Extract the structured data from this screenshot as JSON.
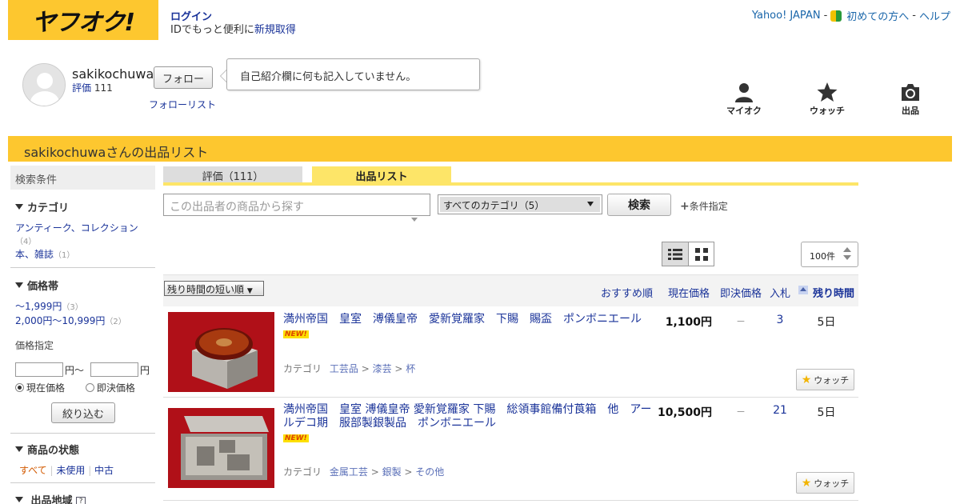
{
  "header": {
    "logo_text": "ヤフオク!",
    "login": "ログイン",
    "id_prefix": "IDでもっと便利に",
    "signup": "新規取得",
    "links": [
      "Yahoo! JAPAN",
      "初めての方へ",
      "ヘルプ"
    ],
    "separator": "-"
  },
  "seller": {
    "name": "sakikochuwa",
    "rating_label": "評価",
    "rating_value": "111",
    "follow": "フォロー",
    "follow_list": "フォローリスト",
    "bio": "自己紹介欄に何も記入していません。"
  },
  "nav": {
    "myauc": "マイオク",
    "watch": "ウォッチ",
    "sell": "出品"
  },
  "list_title": "sakikochuwaさんの出品リスト",
  "tabs": {
    "rating": "評価（111）",
    "listing": "出品リスト"
  },
  "search": {
    "placeholder": "この出品者の商品から探す",
    "category": "すべてのカテゴリ（5）",
    "button": "検索",
    "conditions": "条件指定"
  },
  "per_page": "100件",
  "sidebar": {
    "header": "検索条件",
    "category_title": "カテゴリ",
    "categories": [
      {
        "label": "アンティーク、コレクション",
        "count": "（4）"
      },
      {
        "label": "本、雑誌",
        "count": "（1）"
      }
    ],
    "price_title": "価格帯",
    "prices": [
      {
        "label": "〜1,999円",
        "count": "（3）"
      },
      {
        "label": "2,000円〜10,999円",
        "count": "（2）"
      }
    ],
    "price_specify": "価格指定",
    "yen_tilde": "円〜",
    "yen": "円",
    "radio_current": "現在価格",
    "radio_buynow": "即決価格",
    "narrow": "絞り込む",
    "condition_title": "商品の状態",
    "conditions": [
      "すべて",
      "未使用",
      "中古"
    ],
    "region_title": "出品地域"
  },
  "sort": {
    "select": "残り時間の短い順",
    "recommended": "おすすめ順",
    "current_price": "現在価格",
    "buynow": "即決価格",
    "bids": "入札",
    "time_left": "残り時間"
  },
  "items": [
    {
      "title": "満州帝国　皇室　溥儀皇帝　愛新覚羅家　下賜　賜盃　ポンボニエール",
      "new": "NEW!",
      "cat_label": "カテゴリ",
      "cats": [
        "工芸品",
        "漆芸",
        "杯"
      ],
      "price": "1,100円",
      "buynow": "－",
      "bids": "3",
      "time": "5日",
      "watch": "ウォッチ"
    },
    {
      "title": "満州帝国　皇室 溥儀皇帝 愛新覚羅家 下賜　総領事館備付莨箱　他　アールデコ期　服部製銀製品　ポンボニエール",
      "new": "NEW!",
      "cat_label": "カテゴリ",
      "cats": [
        "金属工芸",
        "銀製",
        "その他"
      ],
      "price": "10,500円",
      "buynow": "－",
      "bids": "21",
      "time": "5日",
      "watch": "ウォッチ"
    }
  ],
  "colors": {
    "brand_yellow": "#fdc72f",
    "tab_yellow": "#fde568",
    "link_blue": "#1a3399"
  }
}
